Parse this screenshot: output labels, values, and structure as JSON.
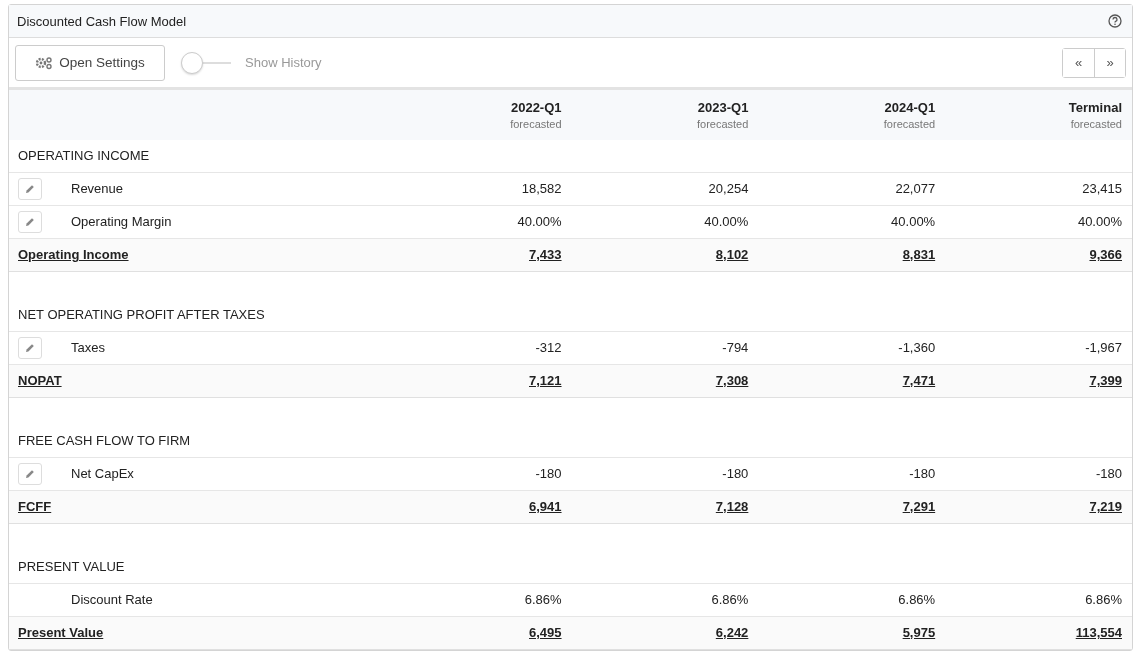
{
  "panel": {
    "title": "Discounted Cash Flow Model"
  },
  "toolbar": {
    "settings_button": "Open Settings",
    "history_toggle": {
      "label": "Show History",
      "on": false
    },
    "prev_button": "«",
    "next_button": "»"
  },
  "table": {
    "columns": [
      {
        "period": "2022-Q1",
        "note": "forecasted"
      },
      {
        "period": "2023-Q1",
        "note": "forecasted"
      },
      {
        "period": "2024-Q1",
        "note": "forecasted"
      },
      {
        "period": "Terminal",
        "note": "forecasted"
      }
    ],
    "sections": [
      {
        "title": "OPERATING INCOME",
        "items": [
          {
            "label": "Revenue",
            "editable": true,
            "values": [
              "18,582",
              "20,254",
              "22,077",
              "23,415"
            ]
          },
          {
            "label": "Operating Margin",
            "editable": true,
            "values": [
              "40.00%",
              "40.00%",
              "40.00%",
              "40.00%"
            ]
          }
        ],
        "total": {
          "label": "Operating Income",
          "values": [
            "7,433",
            "8,102",
            "8,831",
            "9,366"
          ]
        }
      },
      {
        "title": "NET OPERATING PROFIT AFTER TAXES",
        "items": [
          {
            "label": "Taxes",
            "editable": true,
            "values": [
              "-312",
              "-794",
              "-1,360",
              "-1,967"
            ]
          }
        ],
        "total": {
          "label": "NOPAT",
          "values": [
            "7,121",
            "7,308",
            "7,471",
            "7,399"
          ]
        }
      },
      {
        "title": "FREE CASH FLOW TO FIRM",
        "items": [
          {
            "label": "Net CapEx",
            "editable": true,
            "values": [
              "-180",
              "-180",
              "-180",
              "-180"
            ]
          }
        ],
        "total": {
          "label": "FCFF",
          "values": [
            "6,941",
            "7,128",
            "7,291",
            "7,219"
          ]
        }
      },
      {
        "title": "PRESENT VALUE",
        "items": [
          {
            "label": "Discount Rate",
            "editable": false,
            "values": [
              "6.86%",
              "6.86%",
              "6.86%",
              "6.86%"
            ]
          }
        ],
        "total": {
          "label": "Present Value",
          "values": [
            "6,495",
            "6,242",
            "5,975",
            "113,554"
          ]
        }
      }
    ]
  }
}
